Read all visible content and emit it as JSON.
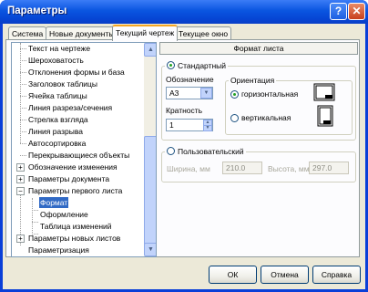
{
  "window": {
    "title": "Параметры",
    "help_glyph": "?",
    "close_glyph": "✕"
  },
  "tabs": [
    {
      "label": "Система"
    },
    {
      "label": "Новые документы"
    },
    {
      "label": "Текущий чертеж"
    },
    {
      "label": "Текущее окно"
    }
  ],
  "tree": {
    "items": [
      {
        "label": "Текст на чертеже"
      },
      {
        "label": "Шероховатость"
      },
      {
        "label": "Отклонения формы и база"
      },
      {
        "label": "Заголовок таблицы"
      },
      {
        "label": "Ячейка таблицы"
      },
      {
        "label": "Линия разреза/сечения"
      },
      {
        "label": "Стрелка взгляда"
      },
      {
        "label": "Линия разрыва"
      },
      {
        "label": "Автосортировка"
      },
      {
        "label": "Перекрывающиеся объекты"
      },
      {
        "label": "Обозначение изменения"
      },
      {
        "label": "Параметры документа"
      },
      {
        "label": "Параметры первого листа"
      },
      {
        "label": "Формат"
      },
      {
        "label": "Оформление"
      },
      {
        "label": "Таблица изменений"
      },
      {
        "label": "Параметры новых листов"
      },
      {
        "label": "Параметризация"
      }
    ],
    "expander_plus": "+",
    "expander_minus": "−"
  },
  "panel": {
    "header": "Формат листа",
    "standard": {
      "label": "Стандартный",
      "designation_label": "Обозначение",
      "designation_value": "А3",
      "multiplicity_label": "Кратность",
      "multiplicity_value": "1",
      "orientation_label": "Ориентация",
      "landscape_label": "горизонтальная",
      "portrait_label": "вертикальная"
    },
    "custom": {
      "label": "Пользовательский",
      "width_label": "Ширина, мм",
      "width_value": "210.0",
      "height_label": "Высота, мм",
      "height_value": "297.0"
    }
  },
  "buttons": {
    "ok": "ОК",
    "cancel": "Отмена",
    "help": "Справка"
  },
  "colors": {
    "title_bar": "#0a55e0",
    "selection": "#316ac5",
    "tab_highlight": "#f5a623",
    "client": "#ece9d8"
  }
}
